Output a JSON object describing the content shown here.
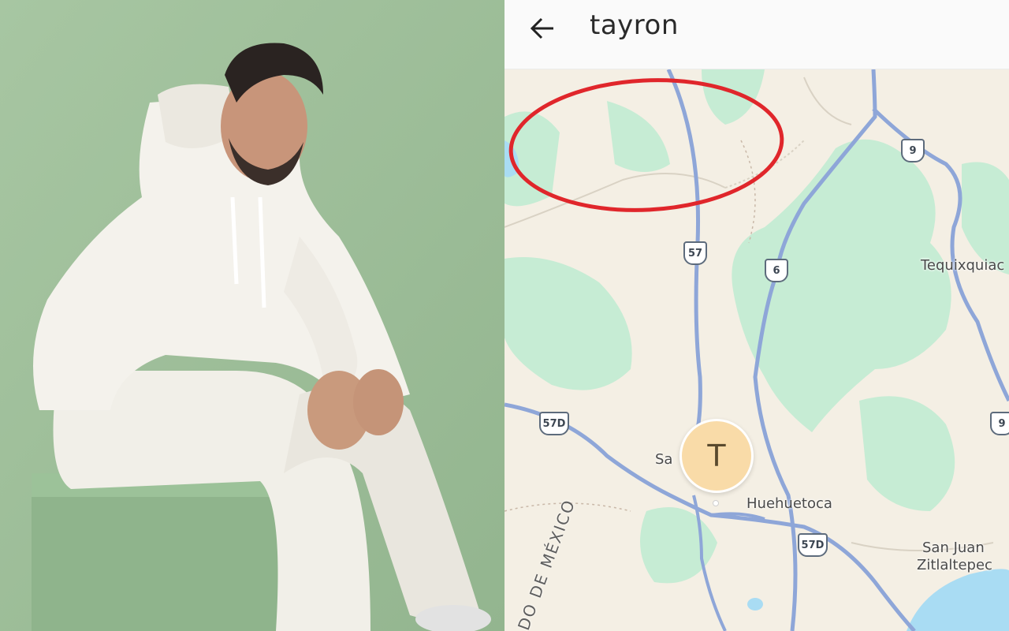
{
  "header": {
    "back_icon": "arrow-left-icon",
    "search_query": "tayron"
  },
  "map": {
    "places": [
      {
        "id": "tequixquiac",
        "label": "Tequixquiac"
      },
      {
        "id": "huehuetoca",
        "label": "Huehuetoca"
      },
      {
        "id": "sa",
        "label": "Sa"
      },
      {
        "id": "san-juan",
        "label": "San Juan"
      },
      {
        "id": "zitlaltepec",
        "label": "Zitlaltepec"
      }
    ],
    "state_label": "DO DE MÉXICO",
    "road_shields": [
      {
        "id": "9-top",
        "label": "9"
      },
      {
        "id": "57",
        "label": "57"
      },
      {
        "id": "6",
        "label": "6"
      },
      {
        "id": "57d-left",
        "label": "57D"
      },
      {
        "id": "9-right",
        "label": "9"
      },
      {
        "id": "57d-bottom",
        "label": "57D"
      }
    ],
    "marker": {
      "initial": "T"
    },
    "colors": {
      "land": "#f4efe4",
      "park": "#c6ecd4",
      "water": "#a9dcf3",
      "highway": "#8ea6d8",
      "highlight": "#e0262b",
      "marker": "#f9dba8"
    }
  },
  "photo": {
    "background": "#9fbf9a",
    "subject": "person-in-white-tracksuit-photo"
  }
}
